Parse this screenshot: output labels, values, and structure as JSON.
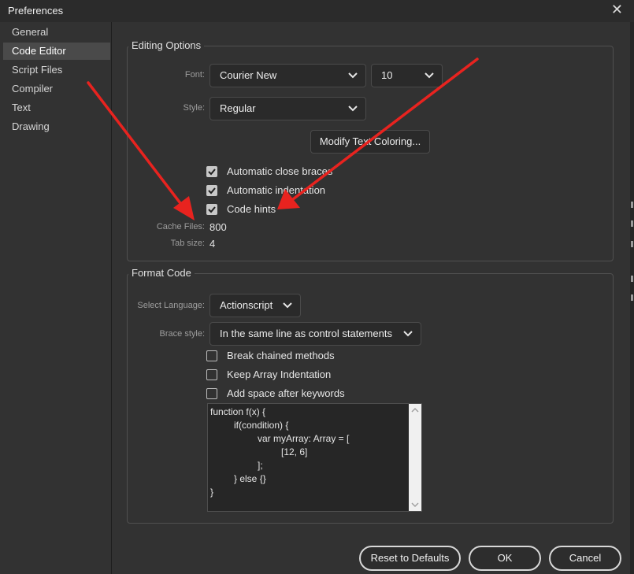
{
  "window": {
    "title": "Preferences",
    "close_symbol": "✕"
  },
  "sidebar": {
    "items": [
      {
        "label": "General"
      },
      {
        "label": "Code Editor",
        "selected": true
      },
      {
        "label": "Script Files"
      },
      {
        "label": "Compiler"
      },
      {
        "label": "Text"
      },
      {
        "label": "Drawing"
      }
    ]
  },
  "editing_options": {
    "title": "Editing Options",
    "font_label": "Font:",
    "font_value": "Courier New",
    "font_size": "10",
    "style_label": "Style:",
    "style_value": "Regular",
    "modify_button": "Modify Text Coloring...",
    "checkboxes": [
      {
        "label": "Automatic close braces",
        "checked": true
      },
      {
        "label": "Automatic indentation",
        "checked": true
      },
      {
        "label": "Code hints",
        "checked": true
      }
    ],
    "cache_label": "Cache Files:",
    "cache_value": "800",
    "tab_label": "Tab size:",
    "tab_value": "4"
  },
  "format_code": {
    "title": "Format Code",
    "language_label": "Select Language:",
    "language_value": "Actionscript",
    "brace_label": "Brace style:",
    "brace_value": "In the same line as control statements",
    "checkboxes": [
      {
        "label": "Break chained methods",
        "checked": false
      },
      {
        "label": "Keep Array Indentation",
        "checked": false
      },
      {
        "label": "Add space after keywords",
        "checked": false
      }
    ],
    "preview_lines": [
      "function f(x) {",
      "if(condition) {",
      "var myArray: Array = [",
      "[12, 6]",
      "];",
      "} else {}",
      "}"
    ]
  },
  "footer": {
    "reset_button": "Reset to Defaults",
    "ok_button": "OK",
    "cancel_button": "Cancel"
  },
  "colors": {
    "background": "#323232",
    "annotation_arrow": "#e8231f"
  },
  "icons": [
    "close-icon",
    "chevron-down-icon",
    "checkmark-icon",
    "scroll-up-icon",
    "scroll-down-icon"
  ]
}
